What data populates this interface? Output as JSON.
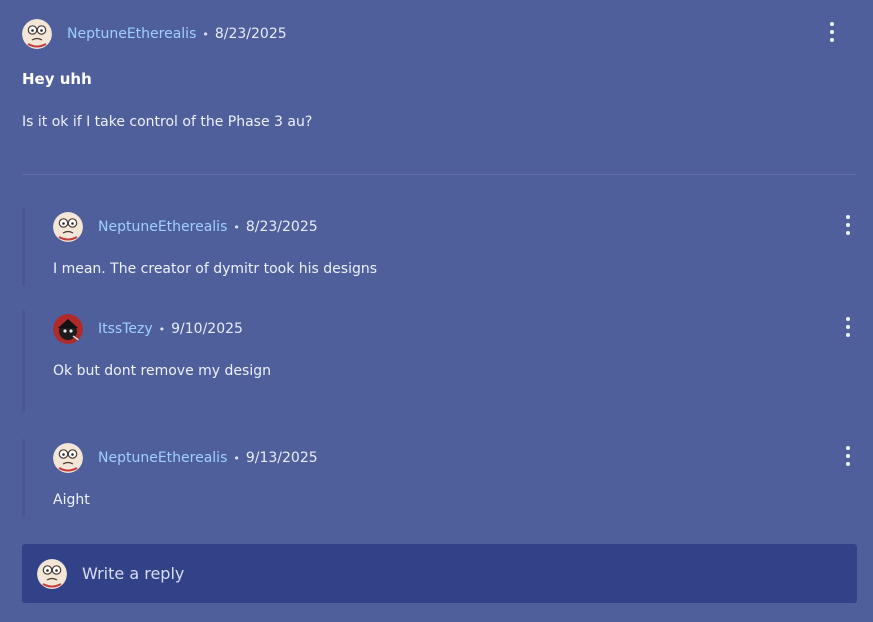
{
  "post": {
    "author": "NeptuneEtherealis",
    "date": "8/23/2025",
    "title": "Hey uhh",
    "body": "Is it ok if I take control of the Phase 3 au?",
    "avatar_icon": "cartoon-face-avatar"
  },
  "separator": "•",
  "replies": [
    {
      "author": "NeptuneEtherealis",
      "date": "8/23/2025",
      "body": "I mean. The creator of dymitr took his designs",
      "avatar_icon": "cartoon-face-avatar"
    },
    {
      "author": "ItssTezy",
      "date": "9/10/2025",
      "body": "Ok but dont remove my design",
      "avatar_icon": "dark-character-avatar"
    },
    {
      "author": "NeptuneEtherealis",
      "date": "9/13/2025",
      "body": "Aight",
      "avatar_icon": "cartoon-face-avatar"
    }
  ],
  "reply_box": {
    "placeholder": "Write a reply",
    "avatar_icon": "cartoon-face-avatar"
  },
  "colors": {
    "background": "#4f5f9b",
    "author_link": "#9fd0ff",
    "reply_box": "#324289"
  }
}
